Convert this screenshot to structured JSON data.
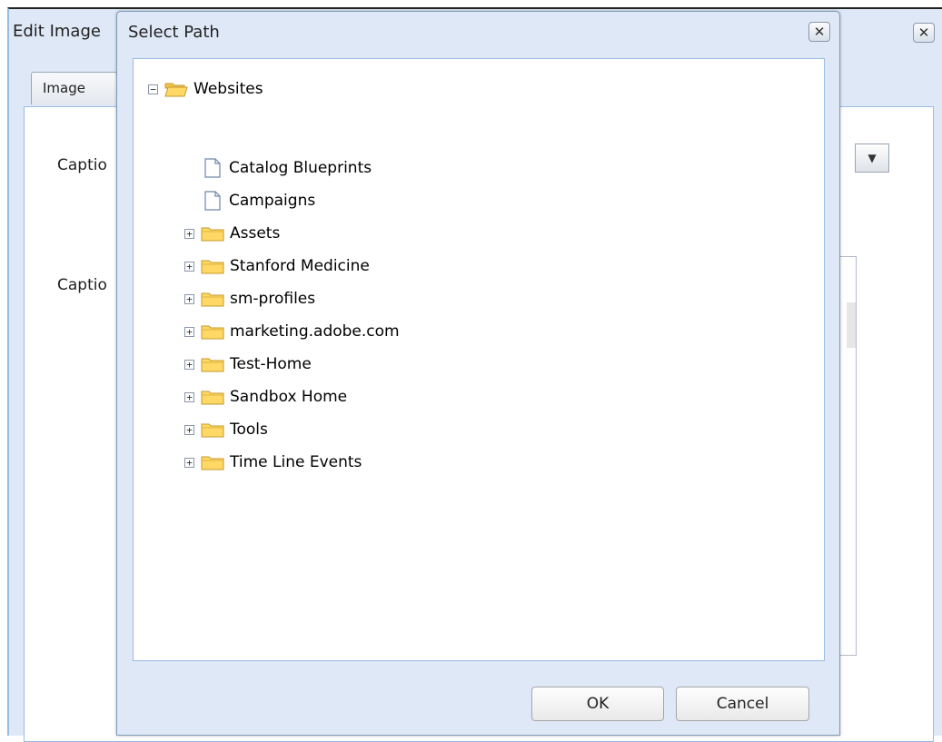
{
  "edit_dialog": {
    "title": "Edit Image",
    "tab_image": "Image",
    "caption_label_1": "Captio",
    "caption_label_2": "Captio"
  },
  "select_path_dialog": {
    "title": "Select Path",
    "close_icon": "close-x",
    "tree": {
      "root": {
        "label": "Websites",
        "expanded": true
      },
      "children": [
        {
          "label": "Catalog Blueprints",
          "type": "page"
        },
        {
          "label": "Campaigns",
          "type": "page"
        },
        {
          "label": "Assets",
          "type": "folder"
        },
        {
          "label": "Stanford Medicine",
          "type": "folder"
        },
        {
          "label": "sm-profiles",
          "type": "folder"
        },
        {
          "label": "marketing.adobe.com",
          "type": "folder"
        },
        {
          "label": "Test-Home",
          "type": "folder"
        },
        {
          "label": "Sandbox Home",
          "type": "folder"
        },
        {
          "label": "Tools",
          "type": "folder"
        },
        {
          "label": "Time Line Events",
          "type": "folder"
        }
      ]
    },
    "ok_label": "OK",
    "cancel_label": "Cancel"
  },
  "colors": {
    "window_bg": "#dfe8f6",
    "border": "#99bbe8",
    "folder_fill": "#ffd865",
    "folder_stroke": "#c59a2e"
  }
}
